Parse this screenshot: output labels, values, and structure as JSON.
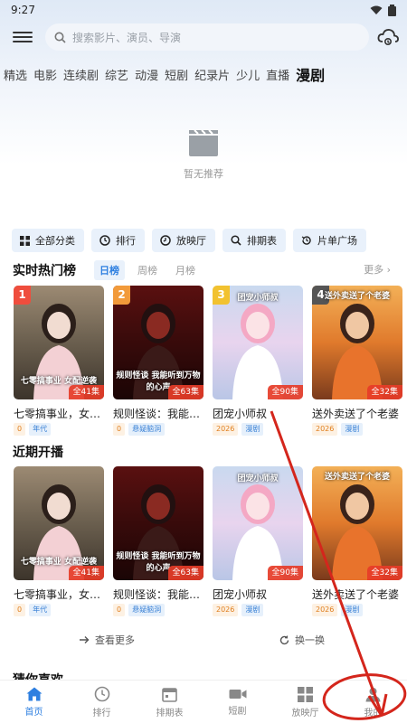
{
  "status": {
    "time": "9:27"
  },
  "search": {
    "placeholder": "搜索影片、演员、导演"
  },
  "category_tabs": [
    "精选",
    "电影",
    "连续剧",
    "综艺",
    "动漫",
    "短剧",
    "纪录片",
    "少儿",
    "直播",
    "漫剧"
  ],
  "category_active": "漫剧",
  "empty": {
    "text": "暂无推荐"
  },
  "quick_links": [
    {
      "label": "全部分类",
      "icon": "grid-icon"
    },
    {
      "label": "排行",
      "icon": "ranking-icon"
    },
    {
      "label": "放映厅",
      "icon": "theater-icon"
    },
    {
      "label": "排期表",
      "icon": "schedule-icon"
    },
    {
      "label": "片单广场",
      "icon": "history-icon"
    }
  ],
  "hot": {
    "title": "实时热门榜",
    "tabs": [
      "日榜",
      "周榜",
      "月榜"
    ],
    "more": "更多 ›",
    "cards": [
      {
        "rank": "1",
        "title": "七零搞事业，女配...",
        "episodes": "全41集",
        "tags": [
          "0",
          "年代"
        ],
        "caption": "七零搞事业 女配逆袭"
      },
      {
        "rank": "2",
        "title": "规则怪谈：我能听...",
        "episodes": "全63集",
        "tags": [
          "0",
          "悬疑脑洞"
        ],
        "caption": "规则怪谈 我能听到万物的心声"
      },
      {
        "rank": "3",
        "title": "团宠小师叔",
        "episodes": "全90集",
        "tags": [
          "2026",
          "漫剧"
        ],
        "caption": "团宠小师叔"
      },
      {
        "rank": "4",
        "title": "送外卖送了个老婆",
        "episodes": "全32集",
        "tags": [
          "2026",
          "漫剧"
        ],
        "caption": "送外卖送了个老婆"
      }
    ]
  },
  "upcoming": {
    "title": "近期开播",
    "cards": [
      {
        "title": "七零搞事业，女配...",
        "episodes": "全41集",
        "tags": [
          "0",
          "年代"
        ],
        "caption": "七零搞事业 女配逆袭"
      },
      {
        "title": "规则怪谈：我能听...",
        "episodes": "全63集",
        "tags": [
          "0",
          "悬疑脑洞"
        ],
        "caption": "规则怪谈 我能听到万物的心声"
      },
      {
        "title": "团宠小师叔",
        "episodes": "全90集",
        "tags": [
          "2026",
          "漫剧"
        ],
        "caption": "团宠小师叔"
      },
      {
        "title": "送外卖送了个老婆",
        "episodes": "全32集",
        "tags": [
          "2026",
          "漫剧"
        ],
        "caption": "送外卖送了个老婆"
      }
    ],
    "see_more": "查看更多",
    "refresh": "换一换"
  },
  "guess": {
    "title": "猜你喜欢"
  },
  "bottom_nav": [
    {
      "label": "首页",
      "icon": "home-icon",
      "active": true
    },
    {
      "label": "排行",
      "icon": "ranking-icon",
      "active": false
    },
    {
      "label": "排期表",
      "icon": "calendar-icon",
      "active": false
    },
    {
      "label": "短剧",
      "icon": "video-icon",
      "active": false
    },
    {
      "label": "放映厅",
      "icon": "grid-icon",
      "active": false
    },
    {
      "label": "我的",
      "icon": "user-icon",
      "active": false
    }
  ],
  "colors": {
    "accent": "#2e7fe0",
    "annotation": "#d4261c",
    "episode_badge": "#e63c28"
  }
}
